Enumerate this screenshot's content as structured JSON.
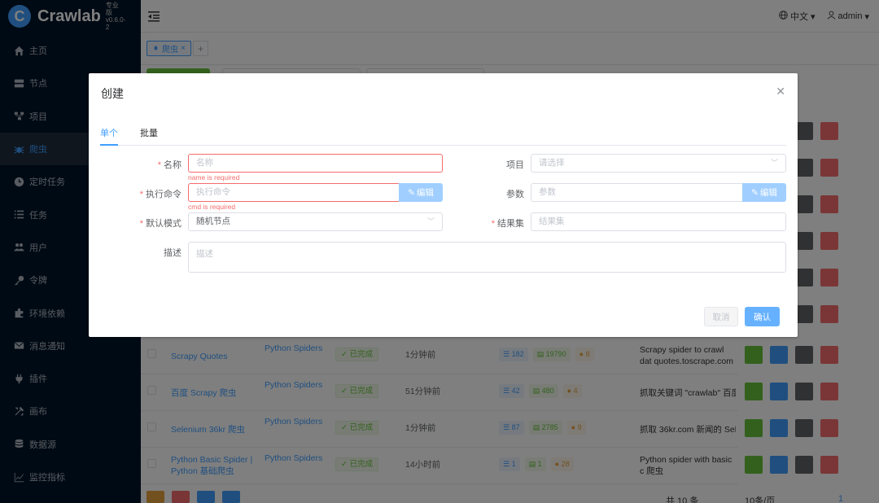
{
  "app": {
    "name": "Crawlab",
    "version": "专业版 v0.6.0-2",
    "logo_letter": "C"
  },
  "sidebar": {
    "items": [
      {
        "label": "主页",
        "icon": "home-icon"
      },
      {
        "label": "节点",
        "icon": "server-icon"
      },
      {
        "label": "项目",
        "icon": "project-icon"
      },
      {
        "label": "爬虫",
        "icon": "spider-icon",
        "active": true
      },
      {
        "label": "定时任务",
        "icon": "clock-icon"
      },
      {
        "label": "任务",
        "icon": "list-icon"
      },
      {
        "label": "用户",
        "icon": "users-icon"
      },
      {
        "label": "令牌",
        "icon": "key-icon"
      },
      {
        "label": "环境依赖",
        "icon": "puzzle-icon"
      },
      {
        "label": "消息通知",
        "icon": "envelope-icon"
      },
      {
        "label": "插件",
        "icon": "plug-icon"
      },
      {
        "label": "画布",
        "icon": "tools-icon"
      },
      {
        "label": "数据源",
        "icon": "database-icon"
      },
      {
        "label": "监控指标",
        "icon": "chart-icon"
      }
    ]
  },
  "header": {
    "language": "中文",
    "user": "admin"
  },
  "tabs": [
    {
      "label": "爬虫"
    }
  ],
  "table": {
    "rows": [
      {
        "name": "Scrapy Quotes",
        "project": "Python Spiders",
        "status": "已完成",
        "time": "1分钟前",
        "tasks": "182",
        "results": "19790",
        "errors": "8",
        "desc": "Scrapy spider to crawl dat quotes.toscrape.com"
      },
      {
        "name": "百度 Scrapy 爬虫",
        "project": "Python Spiders",
        "status": "已完成",
        "time": "51分钟前",
        "tasks": "42",
        "results": "480",
        "errors": "4",
        "desc": "抓取关键词 \"crawlab\" 百度"
      },
      {
        "name": "Selenium 36kr 爬虫",
        "project": "Python Spiders",
        "status": "已完成",
        "time": "1分钟前",
        "tasks": "87",
        "results": "2785",
        "errors": "9",
        "desc": "抓取 36kr.com 新闻的 Sele"
      },
      {
        "name": "Python Basic Spider | Python 基础爬虫",
        "project": "Python Spiders",
        "status": "已完成",
        "time": "14小时前",
        "tasks": "1",
        "results": "1",
        "errors": "28",
        "desc": "Python spider with basic c 爬虫"
      }
    ],
    "total": "共 10 条",
    "page_size": "10条/页",
    "page": "1"
  },
  "dialog": {
    "title": "创建",
    "tabs": [
      "单个",
      "批量"
    ],
    "fields": {
      "name": {
        "label": "名称",
        "placeholder": "名称",
        "error": "name is required"
      },
      "cmd": {
        "label": "执行命令",
        "placeholder": "执行命令",
        "error": "cmd is required",
        "button": "编辑"
      },
      "mode": {
        "label": "默认模式",
        "value": "随机节点"
      },
      "desc": {
        "label": "描述",
        "placeholder": "描述"
      },
      "project": {
        "label": "项目",
        "placeholder": "请选择"
      },
      "param": {
        "label": "参数",
        "placeholder": "参数",
        "button": "编辑"
      },
      "col": {
        "label": "结果集",
        "placeholder": "结果集"
      }
    },
    "cancel": "取消",
    "confirm": "确认"
  },
  "colors": {
    "primary": "#409eff",
    "danger": "#f56c6c",
    "success": "#67c23a",
    "sidebar_bg": "#001529"
  }
}
